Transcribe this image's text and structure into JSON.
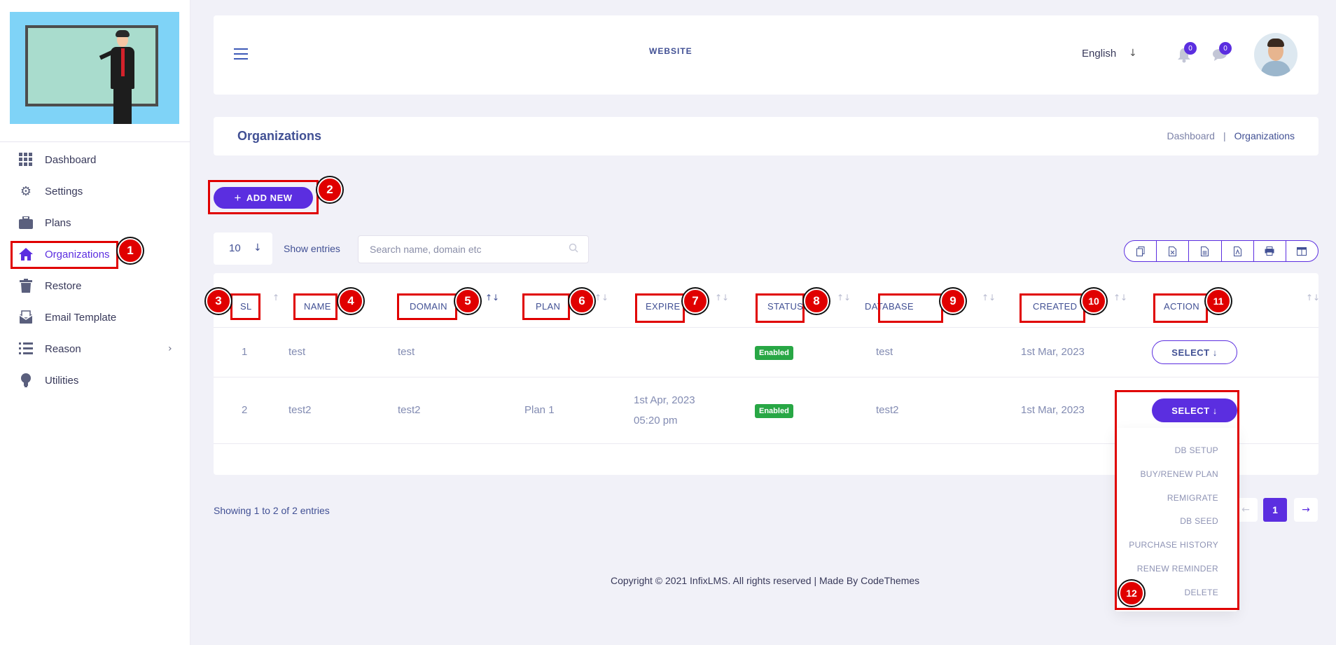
{
  "sidebar": {
    "items": [
      {
        "label": "Dashboard",
        "icon": "grid-icon"
      },
      {
        "label": "Settings",
        "icon": "gear-icon"
      },
      {
        "label": "Plans",
        "icon": "briefcase-icon"
      },
      {
        "label": "Organizations",
        "icon": "home-icon"
      },
      {
        "label": "Restore",
        "icon": "trash-icon"
      },
      {
        "label": "Email Template",
        "icon": "email-icon"
      },
      {
        "label": "Reason",
        "icon": "list-icon"
      },
      {
        "label": "Utilities",
        "icon": "bulb-icon"
      }
    ]
  },
  "header": {
    "site_label": "WEBSITE",
    "language": "English",
    "notifications_count": "0",
    "messages_count": "0"
  },
  "page": {
    "title": "Organizations",
    "breadcrumb": [
      "Dashboard",
      "Organizations"
    ]
  },
  "toolbar": {
    "add_new_label": "ADD NEW",
    "entries_value": "10",
    "show_entries_label": "Show entries",
    "search_placeholder": "Search name, domain etc"
  },
  "table": {
    "columns": [
      "SL",
      "NAME",
      "DOMAIN",
      "PLAN",
      "EXPIRE",
      "STATUS",
      "DATABASE",
      "CREATED",
      "ACTION"
    ],
    "rows": [
      {
        "sl": "1",
        "name": "test",
        "domain": "test",
        "plan": "",
        "expire_date": "",
        "expire_time": "",
        "status": "Enabled",
        "database": "test",
        "created": "1st Mar, 2023",
        "action": "SELECT"
      },
      {
        "sl": "2",
        "name": "test2",
        "domain": "test2",
        "plan": "Plan 1",
        "expire_date": "1st Apr, 2023",
        "expire_time": "05:20 pm",
        "status": "Enabled",
        "database": "test2",
        "created": "1st Mar, 2023",
        "action": "SELECT"
      }
    ]
  },
  "action_menu": [
    "DB SETUP",
    "BUY/RENEW PLAN",
    "REMIGRATE",
    "DB SEED",
    "PURCHASE HISTORY",
    "RENEW REMINDER",
    "DELETE"
  ],
  "pagination": {
    "info": "Showing 1 to 2 of 2 entries",
    "current": "1"
  },
  "footer": {
    "text": "Copyright © 2021 InfixLMS. All rights reserved | Made By CodeThemes"
  },
  "annotations": [
    "1",
    "2",
    "3",
    "4",
    "5",
    "6",
    "7",
    "8",
    "9",
    "10",
    "11",
    "12"
  ],
  "colors": {
    "accent": "#5b2ee0",
    "annotation": "#e00000",
    "status_enabled": "#28a745"
  }
}
